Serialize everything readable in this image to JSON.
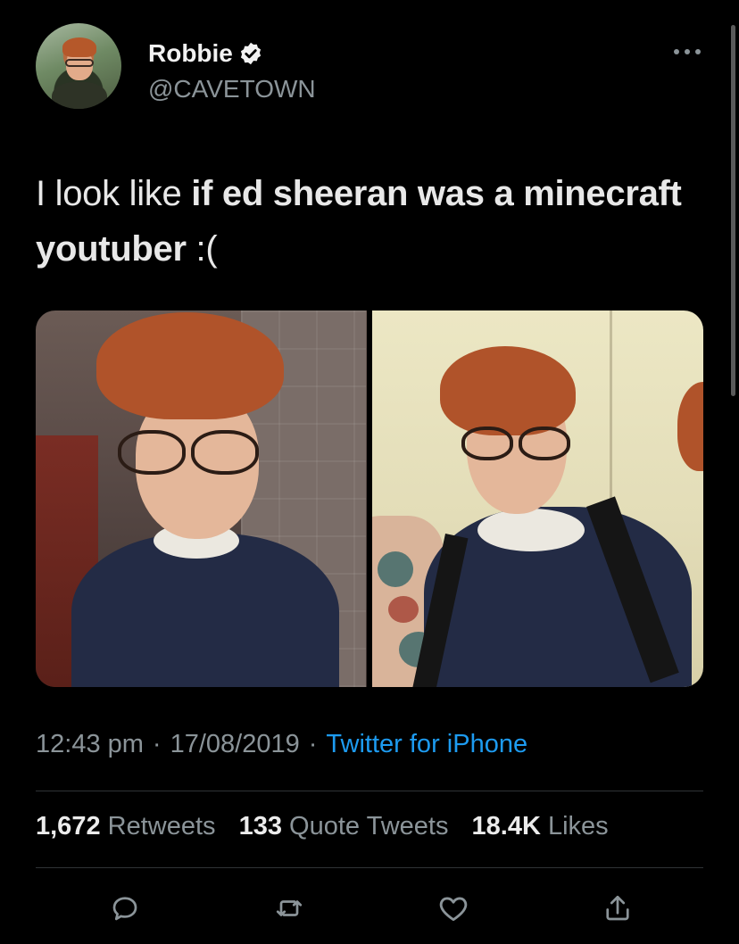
{
  "tweet": {
    "author": {
      "display_name": "Robbie",
      "handle": "@CAVETOWN",
      "verified": true,
      "avatar_icon": "profile-photo"
    },
    "text_plain": "I look like ",
    "text_bold": "if ed sheeran was a minecraft youtuber",
    "text_tail": " :(",
    "media_count": 2,
    "time": "12:43 pm",
    "date": "17/08/2019",
    "source": "Twitter for iPhone",
    "separator": "·",
    "stats": {
      "retweets_count": "1,672",
      "retweets_label": "Retweets",
      "quote_tweets_count": "133",
      "quote_tweets_label": "Quote Tweets",
      "likes_count": "18.4K",
      "likes_label": "Likes"
    },
    "actions": [
      "reply-icon",
      "retweet-icon",
      "like-icon",
      "share-icon"
    ]
  },
  "colors": {
    "background": "#000000",
    "accent": "#1d9bf0",
    "muted_text": "#8b9499",
    "primary_text": "#e8e8e8",
    "divider": "#2f3336"
  }
}
